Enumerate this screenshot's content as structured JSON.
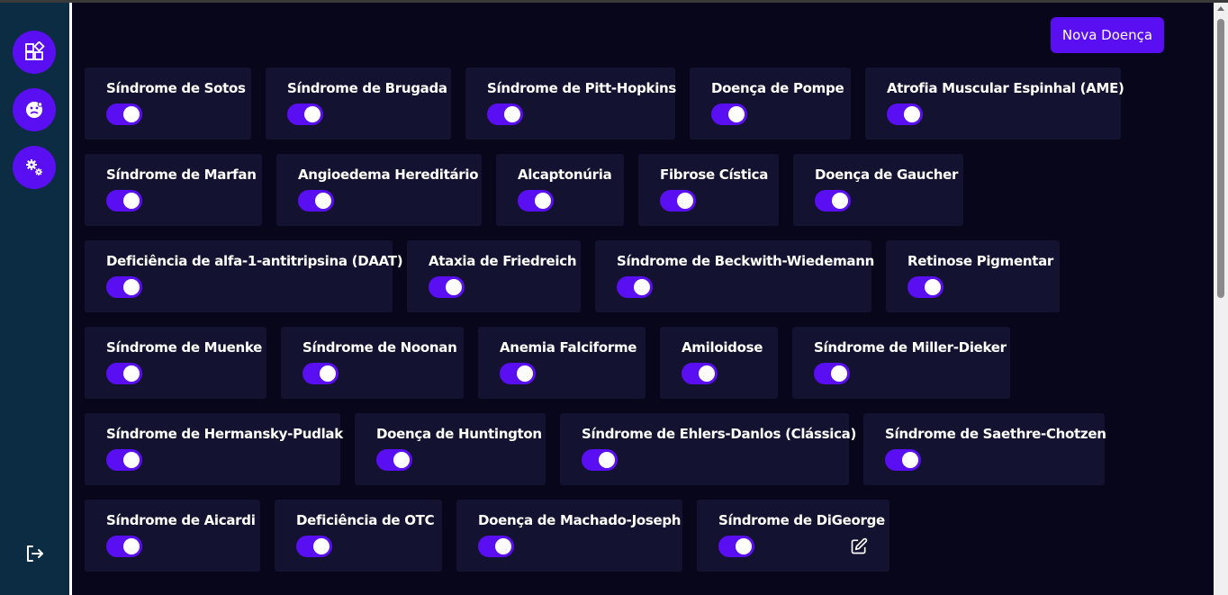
{
  "sidebar": {
    "items": [
      {
        "icon": "dashboard-icon",
        "label": ""
      },
      {
        "icon": "disease-icon",
        "label": ""
      },
      {
        "icon": "settings-gears-icon",
        "label": ""
      }
    ],
    "logout_icon": "logout-icon"
  },
  "header": {
    "new_button_label": "Nova Doença"
  },
  "colors": {
    "accent": "#5a0ef2",
    "background": "#07061a",
    "card": "#131230",
    "sidebar": "#0b2c43"
  },
  "diseases": [
    {
      "name": "Síndrome de Sotos",
      "enabled": true
    },
    {
      "name": "Síndrome de Brugada",
      "enabled": true
    },
    {
      "name": "Síndrome de Pitt-Hopkins",
      "enabled": true
    },
    {
      "name": "Doença de Pompe",
      "enabled": true
    },
    {
      "name": "Atrofia Muscular Espinhal (AME)",
      "enabled": true
    },
    {
      "name": "Síndrome de Marfan",
      "enabled": true
    },
    {
      "name": "Angioedema Hereditário",
      "enabled": true
    },
    {
      "name": "Alcaptonúria",
      "enabled": true
    },
    {
      "name": "Fibrose Cística",
      "enabled": true
    },
    {
      "name": "Doença de Gaucher",
      "enabled": true
    },
    {
      "name": "Deficiência de alfa-1-antitripsina (DAAT)",
      "enabled": true
    },
    {
      "name": "Ataxia de Friedreich",
      "enabled": true
    },
    {
      "name": "Síndrome de Beckwith-Wiedemann",
      "enabled": true
    },
    {
      "name": "Retinose Pigmentar",
      "enabled": true
    },
    {
      "name": "Síndrome de Muenke",
      "enabled": true
    },
    {
      "name": "Síndrome de Noonan",
      "enabled": true
    },
    {
      "name": "Anemia Falciforme",
      "enabled": true
    },
    {
      "name": "Amiloidose",
      "enabled": true
    },
    {
      "name": "Síndrome de Miller-Dieker",
      "enabled": true
    },
    {
      "name": "Síndrome de Hermansky-Pudlak",
      "enabled": true
    },
    {
      "name": "Doença de Huntington",
      "enabled": true
    },
    {
      "name": "Síndrome de Ehlers-Danlos (Clássica)",
      "enabled": true
    },
    {
      "name": "Síndrome de Saethre-Chotzen",
      "enabled": true
    },
    {
      "name": "Síndrome de Aicardi",
      "enabled": true
    },
    {
      "name": "Deficiência de OTC",
      "enabled": true
    },
    {
      "name": "Doença de Machado-Joseph",
      "enabled": true
    },
    {
      "name": "Síndrome de DiGeorge",
      "enabled": true,
      "hover_edit": true
    }
  ]
}
